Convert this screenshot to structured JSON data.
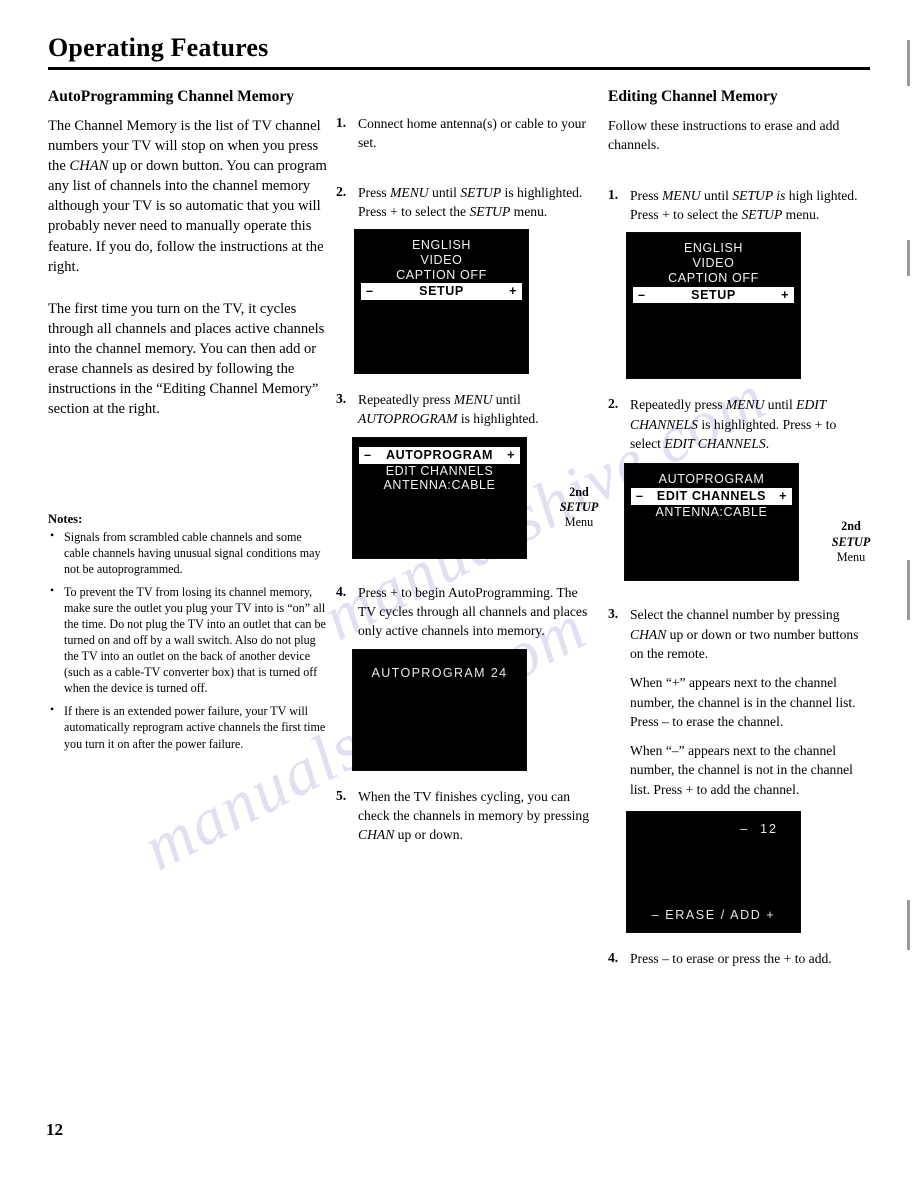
{
  "page": {
    "title": "Operating Features",
    "number": "12"
  },
  "left_column": {
    "heading": "AutoProgramming Channel Memory",
    "paragraph_1": {
      "a": "The Channel Memory is the list of TV channel numbers your TV will stop on when you press the ",
      "em": "CHAN",
      "b": " up or down button.  You can program any list of channels into the channel memory although your TV is so automatic that you will probably never need to manually operate this feature.  If you do, follow the instructions at the right."
    },
    "paragraph_2": "The first time you turn on the TV, it cycles through all channels and places active channels into the channel memory.  You can then add or erase channels as desired by following the instructions in the “Editing Channel Memory” section at the right.",
    "notes_title": "Notes:",
    "notes": [
      "Signals from scrambled cable channels and some cable channels having unusual signal conditions may not be autoprogrammed.",
      "To prevent the TV from losing its channel memory, make sure the outlet you plug your TV into is “on” all the time.  Do not plug the TV into an outlet that can be turned on and off by a wall switch.  Also do not plug the TV into an outlet on the back of another device (such as a cable-TV converter box) that is turned off when the device is turned off.",
      "If there is an extended power failure, your TV will automatically reprogram active channels the first time you turn it on after the power failure."
    ],
    "bullet_glyph": "•"
  },
  "middle_column": {
    "steps": [
      {
        "num": "1.",
        "text": "Connect home antenna(s) or cable to your set."
      },
      {
        "num": "2.",
        "pre": "Press ",
        "em1": "MENU",
        "mid": " until ",
        "em2": "SETUP",
        "mid2": " is highlighted.  Press + to select the ",
        "em3": "SETUP",
        "post": " menu."
      },
      {
        "num": "3.",
        "pre": "Repeatedly press ",
        "em1": "MENU",
        "mid": " until ",
        "em2": "AUTOPROGRAM",
        "post": " is highlighted."
      },
      {
        "num": "4.",
        "text": "Press + to begin AutoProgramming.  The TV cycles through all channels and places only active channels into memory."
      },
      {
        "num": "5.",
        "pre": "When the TV finishes cycling, you can check the channels in memory by pressing ",
        "em1": "CHAN",
        "post": " up or down."
      }
    ],
    "screen_setup": {
      "rows": [
        "ENGLISH",
        "VIDEO",
        "CAPTION OFF"
      ],
      "highlight": "SETUP",
      "minus": "–",
      "plus": "+"
    },
    "screen_autoprogram": {
      "highlight": "AUTOPROGRAM",
      "rows": [
        "EDIT CHANNELS",
        "ANTENNA:CABLE"
      ],
      "minus": "–",
      "plus": "+",
      "caption_l1": "2nd",
      "caption_l2": "SETUP",
      "caption_l3": "Menu"
    },
    "screen_counter": {
      "text": "AUTOPROGRAM  24"
    }
  },
  "right_column": {
    "heading": "Editing Channel Memory",
    "intro": "Follow these instructions to erase and add channels.",
    "steps": [
      {
        "num": "1.",
        "pre": "Press  ",
        "em1": "MENU",
        "mid": " until ",
        "em2": "SETUP is",
        "mid2": " high lighted.  Press + to select the ",
        "em3": "SETUP",
        "post": " menu."
      },
      {
        "num": "2.",
        "pre": "Repeatedly press ",
        "em1": "MENU",
        "mid": " until ",
        "em2": "EDIT CHANNELS",
        "mid2": "  is highlighted.  Press + to select ",
        "em3": "EDIT CHANNELS",
        "post": "."
      },
      {
        "num": "3.",
        "pre": "Select the channel number by pressing ",
        "em1": "CHAN",
        "post": " up or down or two number buttons on the remote.",
        "para2": "When “+” appears next to the channel number, the channel is in the channel list.  Press – to erase the channel.",
        "para3": "When “–” appears next to the channel number, the channel is not in the channel list.  Press + to add the channel."
      },
      {
        "num": "4.",
        "text": "Press –  to erase or press the + to add."
      }
    ],
    "screen_setup": {
      "rows": [
        "ENGLISH",
        "VIDEO",
        "CAPTION OFF"
      ],
      "highlight": "SETUP",
      "minus": "–",
      "plus": "+"
    },
    "screen_edit_channels": {
      "rows_top": [
        "AUTOPROGRAM"
      ],
      "highlight": "EDIT CHANNELS",
      "rows_bottom": [
        "ANTENNA:CABLE"
      ],
      "minus": "–",
      "plus": "+",
      "caption_l1": "2nd",
      "caption_l2": "SETUP",
      "caption_l3": "Menu"
    },
    "screen_erase_add": {
      "channel_sign": "–",
      "channel_number": "12",
      "bottom_text": "–  ERASE / ADD  +"
    }
  }
}
